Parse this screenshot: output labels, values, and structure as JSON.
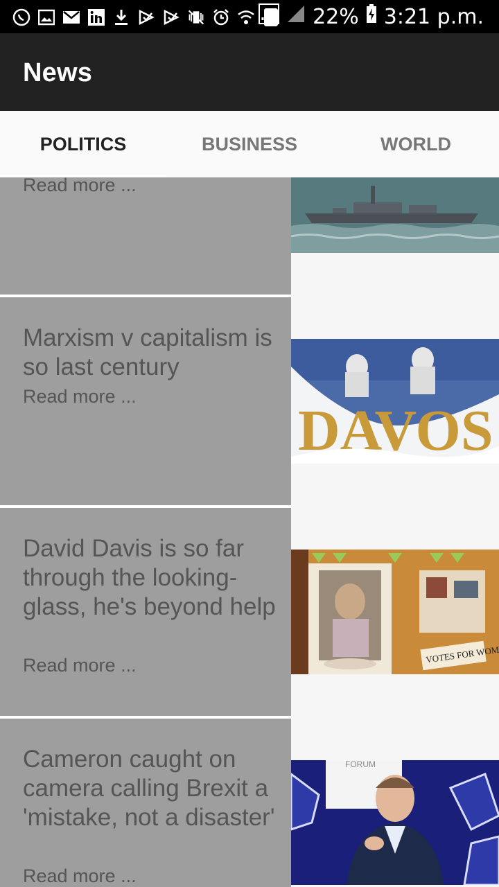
{
  "status_bar": {
    "battery_percent": "22%",
    "time": "3:21 p.m.",
    "sim_slot": "1",
    "icons": [
      "whatsapp-icon",
      "gallery-icon",
      "mail-icon",
      "linkedin-icon",
      "download-icon",
      "play-store-icon",
      "play-store-icon",
      "vibrate-off-icon",
      "alarm-icon",
      "wifi-icon",
      "sim-icon",
      "signal-icon",
      "signal-icon",
      "battery-charging-icon"
    ]
  },
  "app_bar": {
    "title": "News"
  },
  "tabs": [
    {
      "label": "POLITICS",
      "active": true
    },
    {
      "label": "BUSINESS",
      "active": false
    },
    {
      "label": "WORLD",
      "active": false
    }
  ],
  "articles": [
    {
      "title": "",
      "read_more": "Read more ...",
      "image": "warship-image"
    },
    {
      "title": "Marxism v capitalism is so last century",
      "read_more": "Read more ...",
      "image": "davos-sign-image"
    },
    {
      "title": "David Davis is so far through the looking-glass, he's beyond help",
      "read_more": "Read more ...",
      "image": "suffragette-exhibit-image"
    },
    {
      "title": "Cameron caught on camera calling Brexit a 'mistake, not a disaster'",
      "read_more": "Read more ...",
      "image": "cameron-forum-image"
    }
  ],
  "image_texts": {
    "davos": "DAVOS",
    "votes_sign": "VOTES FOR WOMEN",
    "forum": "FORUM"
  },
  "colors": {
    "status_bar": "#000000",
    "app_bar": "#212121",
    "tab_bar": "#fafafa",
    "card_bg": "#9e9e9e",
    "card_text": "#555555"
  }
}
